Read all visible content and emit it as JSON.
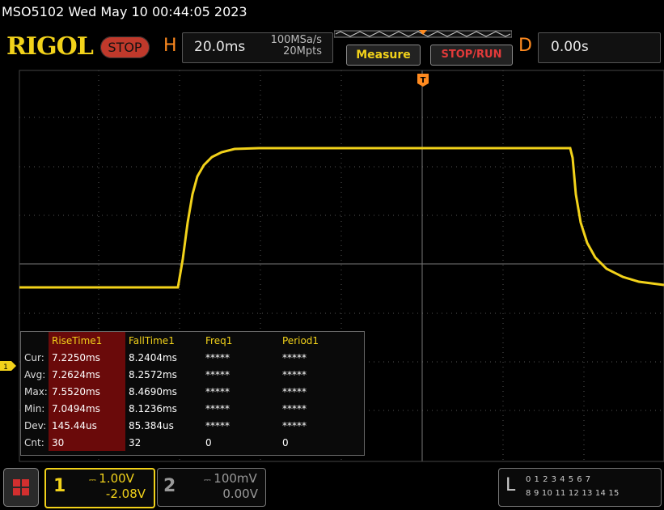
{
  "header": {
    "title": "MSO5102  Wed May 10 00:44:05 2023",
    "logo": "RIGOL",
    "stop_label": "STOP",
    "h_letter": "H",
    "timebase": "20.0ms",
    "sample_rate": "100MSa/s",
    "memory_depth": "20Mpts",
    "measure_label": "Measure",
    "stoprun_label": "STOP/RUN",
    "d_letter": "D",
    "delay": "0.00s"
  },
  "trigger_marker": "T",
  "channel1_marker": "1",
  "measurements": {
    "columns": [
      "RiseTime1",
      "FallTime1",
      "Freq1",
      "Period1"
    ],
    "rows": [
      {
        "label": "Cur:",
        "values": [
          "7.2250ms",
          "8.2404ms",
          "*****",
          "*****"
        ]
      },
      {
        "label": "Avg:",
        "values": [
          "7.2624ms",
          "8.2572ms",
          "*****",
          "*****"
        ]
      },
      {
        "label": "Max:",
        "values": [
          "7.5520ms",
          "8.4690ms",
          "*****",
          "*****"
        ]
      },
      {
        "label": "Min:",
        "values": [
          "7.0494ms",
          "8.1236ms",
          "*****",
          "*****"
        ]
      },
      {
        "label": "Dev:",
        "values": [
          "145.44us",
          "85.384us",
          "*****",
          "*****"
        ]
      },
      {
        "label": "Cnt:",
        "values": [
          "30",
          "32",
          "0",
          "0"
        ]
      }
    ]
  },
  "channels": {
    "ch1": {
      "number": "1",
      "scale": "1.00V",
      "offset": "-2.08V",
      "color": "#f2d21a"
    },
    "ch2": {
      "number": "2",
      "scale": "100mV",
      "offset": "0.00V",
      "color": "#999999"
    }
  },
  "logic": {
    "letter": "L",
    "row1": "0 1 2 3   4 5 6 7",
    "row2": "8 9 10 11 12 13 14 15"
  },
  "colors": {
    "trace": "#f2d21a",
    "accent": "#ff8a1f",
    "grid": "#555555"
  },
  "icons": {
    "menu": "menu-grid-icon",
    "trigger": "trigger-t-icon"
  }
}
